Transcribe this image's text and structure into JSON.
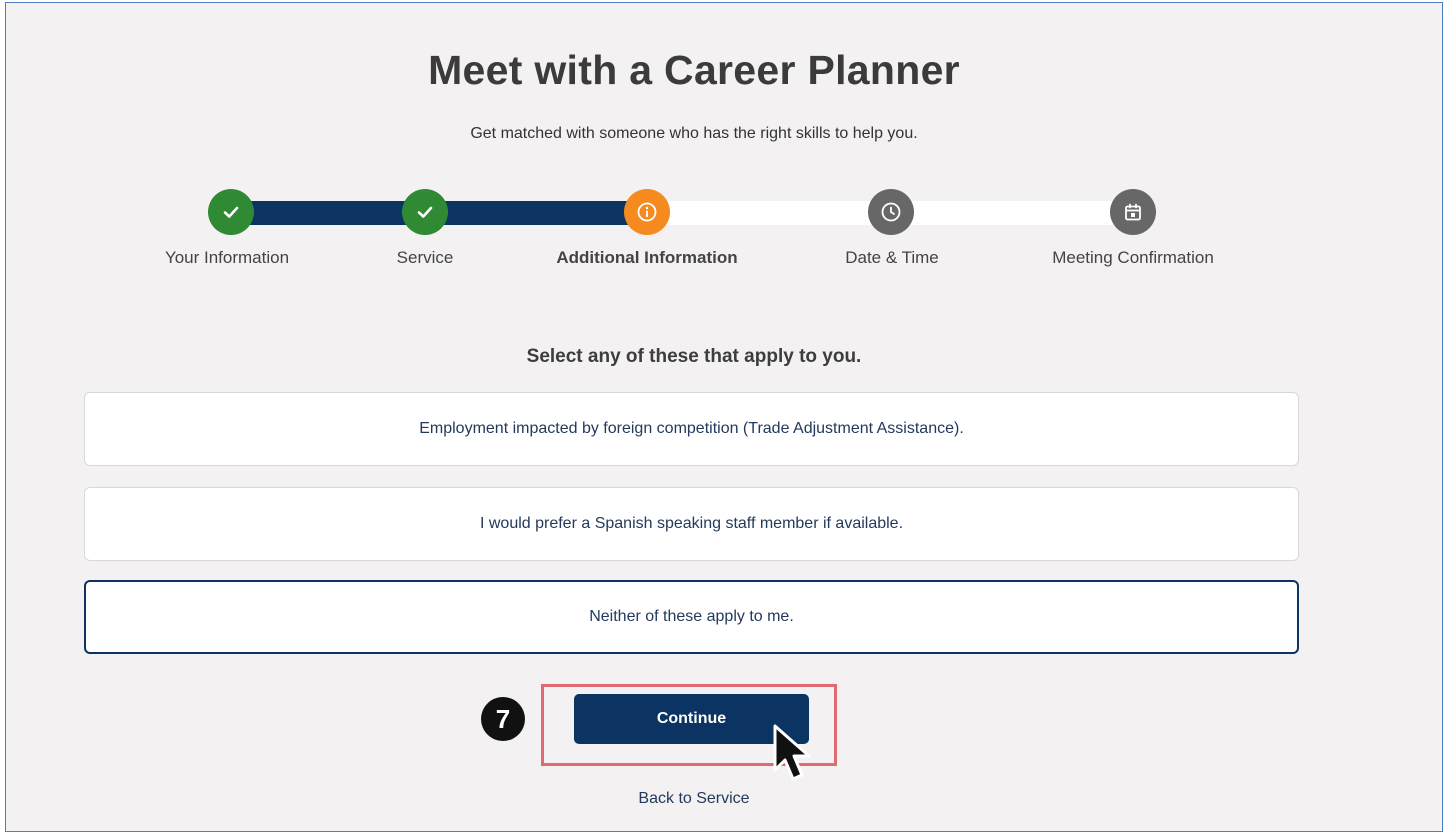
{
  "header": {
    "title": "Meet with a Career Planner",
    "subtitle": "Get matched with someone who has the right skills to help you."
  },
  "stepper": {
    "steps": [
      {
        "label": "Your Information",
        "status": "complete",
        "icon": "check-icon"
      },
      {
        "label": "Service",
        "status": "complete",
        "icon": "check-icon"
      },
      {
        "label": "Additional Information",
        "status": "current",
        "icon": "info-icon"
      },
      {
        "label": "Date & Time",
        "status": "pending",
        "icon": "clock-icon"
      },
      {
        "label": "Meeting Confirmation",
        "status": "pending",
        "icon": "calendar-icon"
      }
    ]
  },
  "form": {
    "prompt": "Select any of these that apply to you.",
    "options": [
      {
        "label": "Employment impacted by foreign competition (Trade Adjustment Assistance).",
        "selected": false
      },
      {
        "label": "I would prefer a Spanish speaking staff member if available.",
        "selected": false
      },
      {
        "label": "Neither of these apply to me.",
        "selected": true
      }
    ],
    "continue_label": "Continue",
    "back_label": "Back to Service"
  },
  "annotation": {
    "step_number": "7"
  },
  "colors": {
    "primary": "#0b3462",
    "complete": "#2f8a33",
    "current": "#f58b1f",
    "pending": "#676767",
    "highlight": "#e06a72"
  }
}
